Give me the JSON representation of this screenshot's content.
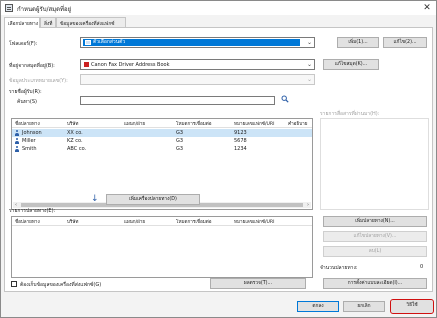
{
  "window": {
    "title": "กำหนดผู้รับ/สมุดที่อยู่"
  },
  "tabs": [
    {
      "label": "เลือกปลายทาง"
    },
    {
      "label": "สิ่งที่"
    },
    {
      "label": "ข้อมูลของเครื่องที่ส่งแฟกซ์"
    }
  ],
  "main": {
    "folder_label": "โฟลเดอร์(F):",
    "folder_value": "ตัวเลือกส่วนตัว",
    "new_button": "เพิ่ม(1)...",
    "edit_button": "แก้ไข(2)...",
    "addressbook_label": "ที่อยู่จากสมุดที่อยู่(B):",
    "addressbook_value": "Canon Fax Driver Address Book",
    "addressbook_settings_button": "แก้ไขสมุด(K)...",
    "addressbook_type_label": "ข้อมูลประเภทหมายเลข(Y):",
    "search_label": "ค้นหา(S)",
    "search_placeholder": "",
    "search_icon": "magnifier",
    "recipient_list_title": "รายชื่อผู้รับ(R):",
    "columns": [
      "ชื่อปลายทาง",
      "บริษัท",
      "แผนก/ฝ่าย",
      "โหมดการเชื่อมต่อ",
      "หมายเลขแฟกซ์/URI",
      "คำอธิบาย"
    ],
    "rows": [
      {
        "name": "Johnson",
        "company": "XX co.",
        "dept": "",
        "mode": "G3",
        "number": "9123",
        "desc": ""
      },
      {
        "name": "Miller",
        "company": "KZ co.",
        "dept": "",
        "mode": "G3",
        "number": "5678",
        "desc": ""
      },
      {
        "name": "Smith",
        "company": "ABC co.",
        "dept": "",
        "mode": "G3",
        "number": "1234",
        "desc": ""
      }
    ],
    "right_group_title": "รายการสื่อสารที่ผ่านมา(H):",
    "add_to_list_button": "เพิ่มเครื่องปลายทาง(D)",
    "dest_list_title": "รายการปลายทาง(E):",
    "dest_columns": [
      "ชื่อปลายทาง",
      "บริษัท",
      "แผนก/ฝ่าย",
      "โหมดการเชื่อมต่อ",
      "หมายเลขแฟกซ์/URI"
    ],
    "dest_add_button": "เพิ่มปลายทาง(N)...",
    "dest_edit_button": "แก้ไขปลายทาง(V)...",
    "dest_delete_button": "ลบ(L)",
    "dest_count_label": "จำนวนปลายทาง:",
    "dest_count_value": "0",
    "store_checkbox_label": "ต้องเก็บข้อมูลของเครื่องที่ส่งแฟกซ์(G)",
    "details_button": "ผลตรวจ(T)...",
    "cover_button": "การตั้งค่าแบบละเอียด(I)..."
  },
  "footer": {
    "ok": "ตกลง",
    "cancel": "ยกเลิก",
    "help": "วิธีใช้"
  },
  "colors": {
    "accent": "#0078d7",
    "highlight": "#d01010",
    "selection": "#cce4f7"
  }
}
